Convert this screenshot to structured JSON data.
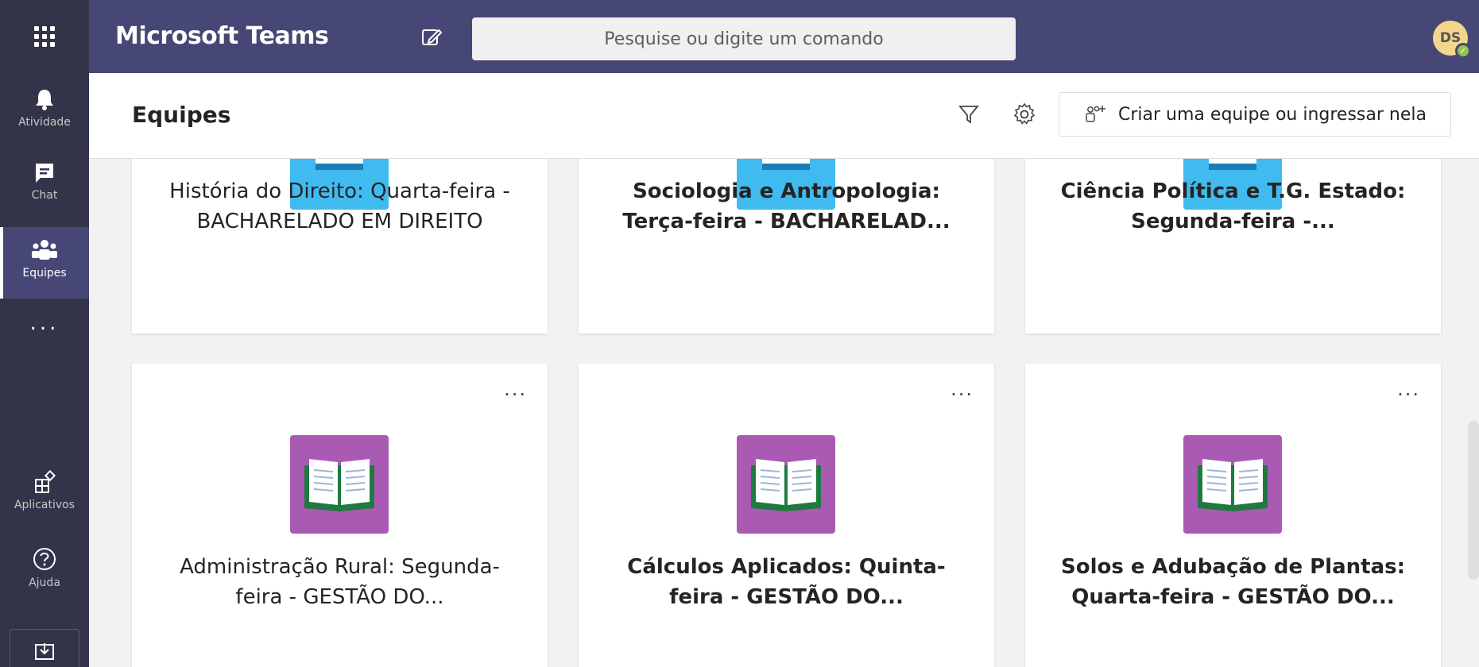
{
  "topbar": {
    "app_title": "Microsoft Teams",
    "search_placeholder": "Pesquise ou digite um comando",
    "avatar_initials": "DS",
    "accent_color": "#464775"
  },
  "rail": {
    "items": [
      {
        "label": "Atividade",
        "icon": "bell-icon"
      },
      {
        "label": "Chat",
        "icon": "chat-icon"
      },
      {
        "label": "Equipes",
        "icon": "teams-icon",
        "active": true
      },
      {
        "label": "...",
        "icon": "more-icon"
      },
      {
        "label": "Aplicativos",
        "icon": "apps-icon"
      },
      {
        "label": "Ajuda",
        "icon": "help-icon"
      },
      {
        "label": "",
        "icon": "download-icon"
      }
    ]
  },
  "header": {
    "title": "Equipes",
    "create_button": "Criar uma equipe ou ingressar nela"
  },
  "teams": [
    {
      "name_line1": "História do Direito: Quarta-feira -",
      "name_line2": "BACHARELADO EM DIREITO",
      "bold": false,
      "tile": "blue"
    },
    {
      "name_line1": "Sociologia e Antropologia:",
      "name_line2": "Terça-feira - BACHARELAD...",
      "bold": true,
      "tile": "blue"
    },
    {
      "name_line1": "Ciência Política e T.G. Estado:",
      "name_line2": "Segunda-feira -...",
      "bold": true,
      "tile": "blue"
    },
    {
      "name_line1": "Administração Rural: Segunda-",
      "name_line2": "feira - GESTÃO DO...",
      "bold": false,
      "tile": "purple",
      "more": "..."
    },
    {
      "name_line1": "Cálculos Aplicados: Quinta-",
      "name_line2": "feira - GESTÃO DO...",
      "bold": true,
      "tile": "purple",
      "more": "..."
    },
    {
      "name_line1": "Solos e Adubação de Plantas:",
      "name_line2": "Quarta-feira - GESTÃO DO...",
      "bold": true,
      "tile": "purple",
      "more": "..."
    }
  ]
}
